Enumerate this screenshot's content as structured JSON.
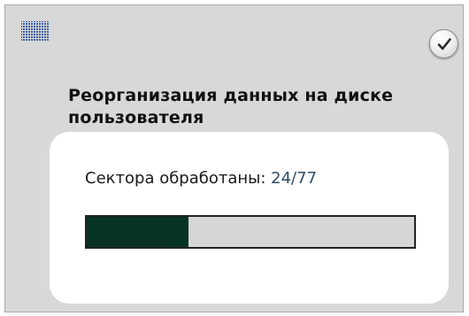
{
  "window": {
    "title": "Реорганизация данных на диске пользователя",
    "icons": {
      "menu": "grid-icon",
      "confirm": "checkmark-icon"
    }
  },
  "progress": {
    "label": "Сектора обработаны: ",
    "count": "24/77",
    "processed": 24,
    "total": 77,
    "fraction": 0.3117
  },
  "colors": {
    "window_bg": "#d8d8d8",
    "card_bg": "#ffffff",
    "progress_fill": "#073325",
    "progress_track": "#d6d6d6",
    "count_text": "#2f4b63"
  }
}
